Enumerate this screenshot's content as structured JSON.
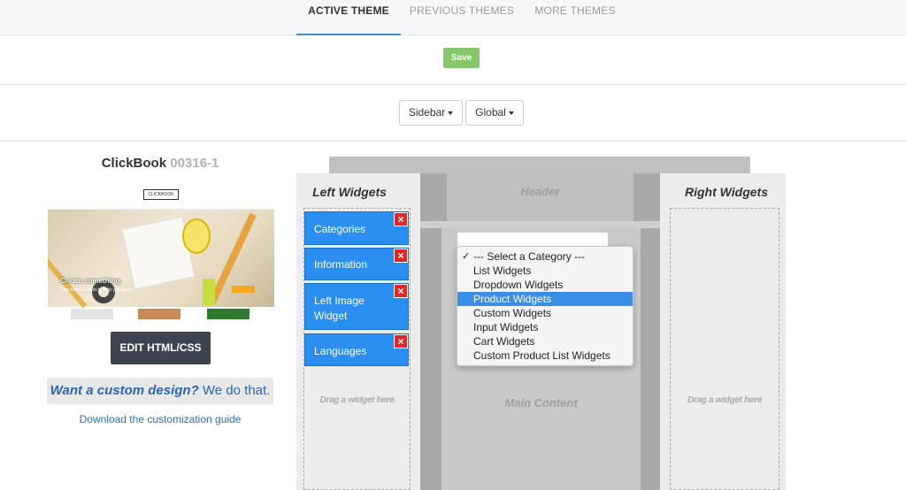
{
  "tabs": [
    {
      "label": "ACTIVE THEME",
      "active": true
    },
    {
      "label": "PREVIOUS THEMES",
      "active": false
    },
    {
      "label": "MORE THEMES",
      "active": false
    }
  ],
  "save_label": "Save",
  "filters": {
    "sidebar_label": "Sidebar",
    "global_label": "Global"
  },
  "theme": {
    "name": "ClickBook",
    "code": "00316-1",
    "preview": {
      "logo": "CLICKBOOK",
      "caption": "Create something.",
      "subcaption": "Checkout our tools to help you create"
    },
    "edit_button": "EDIT HTML/CSS",
    "custom_question": "Want a custom design?",
    "custom_answer": "We do that.",
    "guide_link": "Download the customization guide"
  },
  "layout": {
    "left_title": "Left Widgets",
    "right_title": "Right Widgets",
    "header_label": "Header",
    "main_label": "Main Content",
    "drag_hint": "Drag a widget here",
    "left_widgets": [
      {
        "label": "Categories"
      },
      {
        "label": "Information"
      },
      {
        "label": "Left Image Widget"
      },
      {
        "label": "Languages"
      }
    ]
  },
  "category_menu": {
    "options": [
      {
        "label": "--- Select a Category ---",
        "checked": true,
        "highlighted": false
      },
      {
        "label": "List Widgets",
        "checked": false,
        "highlighted": false
      },
      {
        "label": "Dropdown Widgets",
        "checked": false,
        "highlighted": false
      },
      {
        "label": "Product Widgets",
        "checked": false,
        "highlighted": true
      },
      {
        "label": "Custom Widgets",
        "checked": false,
        "highlighted": false
      },
      {
        "label": "Input Widgets",
        "checked": false,
        "highlighted": false
      },
      {
        "label": "Cart Widgets",
        "checked": false,
        "highlighted": false
      },
      {
        "label": "Custom Product List Widgets",
        "checked": false,
        "highlighted": false
      }
    ]
  },
  "colors": {
    "accent": "#3a8fd9",
    "save_green": "#86c76c",
    "widget_blue": "#2a8ef0",
    "remove_red": "#e02828",
    "edit_dark": "#3d4450"
  }
}
